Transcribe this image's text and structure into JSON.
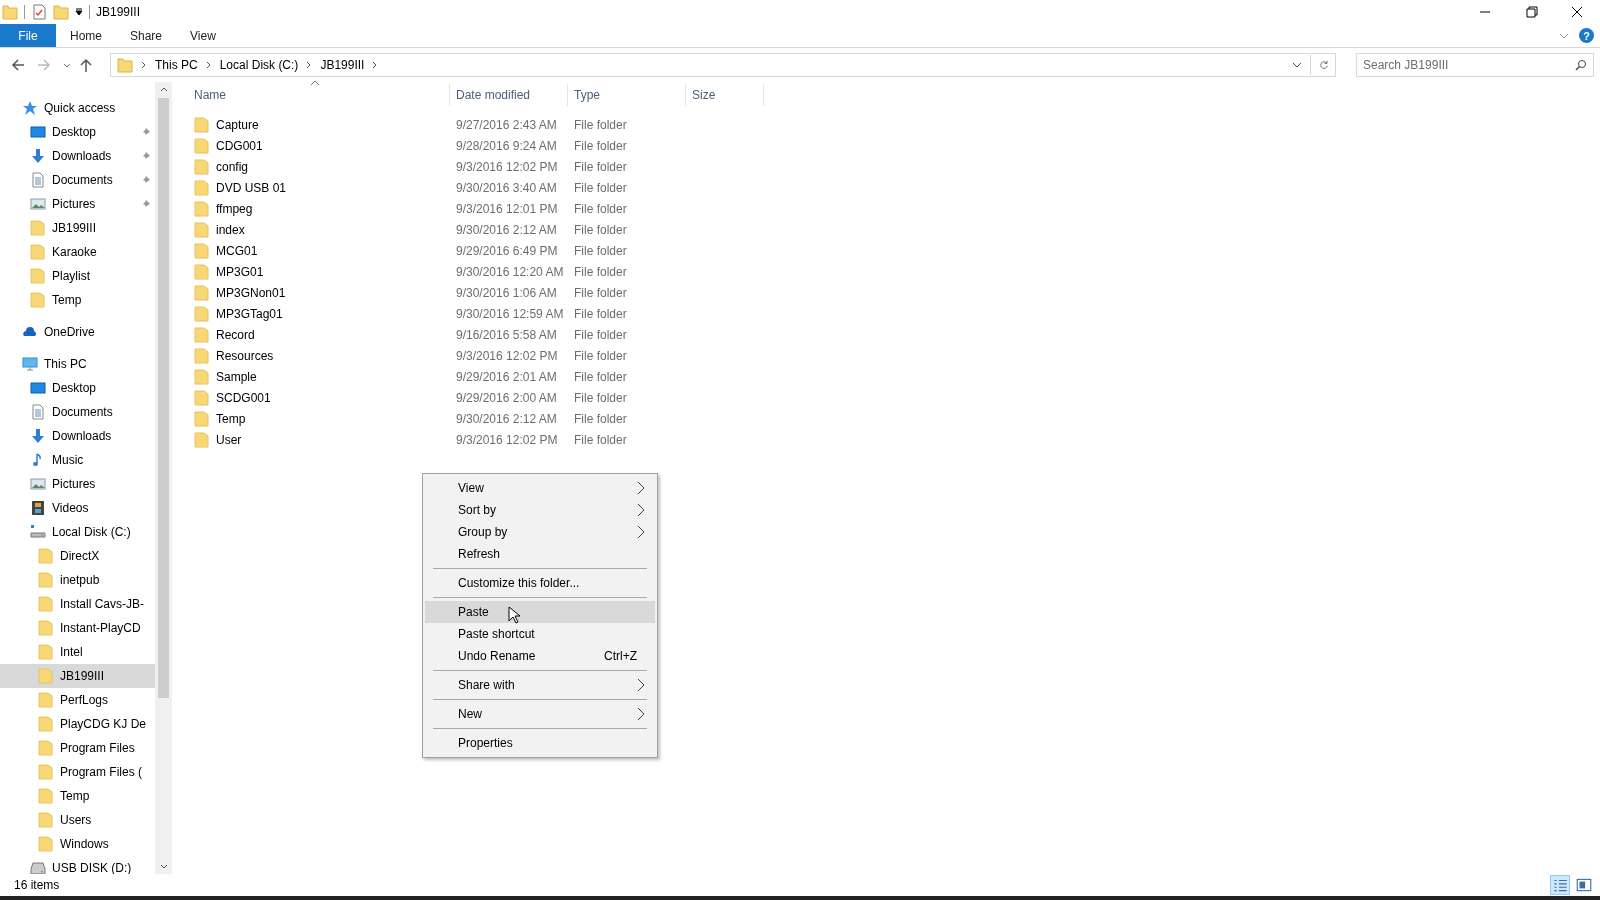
{
  "window": {
    "title": "JB199III",
    "help": "?"
  },
  "ribbon_tabs": [
    {
      "label": "File",
      "kind": "file",
      "selected": true
    },
    {
      "label": "Home",
      "kind": "tab",
      "selected": false
    },
    {
      "label": "Share",
      "kind": "tab",
      "selected": false
    },
    {
      "label": "View",
      "kind": "tab",
      "selected": false
    }
  ],
  "address_bar": {
    "path": [
      "This PC",
      "Local Disk (C:)",
      "JB199III"
    ]
  },
  "search": {
    "placeholder": "Search JB199III"
  },
  "sidebar": {
    "items": [
      {
        "label": "Quick access",
        "kind": "quick-access",
        "selected": false,
        "children": [
          {
            "label": "Desktop",
            "kind": "desktop",
            "pinned": true,
            "selected": false
          },
          {
            "label": "Downloads",
            "kind": "downloads",
            "pinned": true,
            "selected": false
          },
          {
            "label": "Documents",
            "kind": "documents",
            "pinned": true,
            "selected": false
          },
          {
            "label": "Pictures",
            "kind": "pictures",
            "pinned": true,
            "selected": false
          },
          {
            "label": "JB199III",
            "kind": "folder",
            "pinned": false,
            "selected": false
          },
          {
            "label": "Karaoke",
            "kind": "folder",
            "pinned": false,
            "selected": false
          },
          {
            "label": "Playlist",
            "kind": "folder",
            "pinned": false,
            "selected": false
          },
          {
            "label": "Temp",
            "kind": "folder",
            "pinned": false,
            "selected": false
          }
        ]
      },
      {
        "label": "OneDrive",
        "kind": "onedrive",
        "selected": false
      },
      {
        "label": "This PC",
        "kind": "pc",
        "selected": false,
        "children": [
          {
            "label": "Desktop",
            "kind": "desktop",
            "selected": false
          },
          {
            "label": "Documents",
            "kind": "documents",
            "selected": false
          },
          {
            "label": "Downloads",
            "kind": "downloads",
            "selected": false
          },
          {
            "label": "Music",
            "kind": "music",
            "selected": false
          },
          {
            "label": "Pictures",
            "kind": "pictures",
            "selected": false
          },
          {
            "label": "Videos",
            "kind": "videos",
            "selected": false
          },
          {
            "label": "Local Disk (C:)",
            "kind": "drive",
            "selected": false,
            "children": [
              {
                "label": "DirectX",
                "kind": "folder",
                "selected": false
              },
              {
                "label": "inetpub",
                "kind": "folder",
                "selected": false
              },
              {
                "label": "Install Cavs-JB-",
                "kind": "folder",
                "selected": false
              },
              {
                "label": "Instant-PlayCD",
                "kind": "folder",
                "selected": false
              },
              {
                "label": "Intel",
                "kind": "folder",
                "selected": false
              },
              {
                "label": "JB199III",
                "kind": "folder",
                "selected": true
              },
              {
                "label": "PerfLogs",
                "kind": "folder",
                "selected": false
              },
              {
                "label": "PlayCDG KJ De",
                "kind": "folder",
                "selected": false
              },
              {
                "label": "Program Files",
                "kind": "folder",
                "selected": false
              },
              {
                "label": "Program Files (",
                "kind": "folder",
                "selected": false
              },
              {
                "label": "Temp",
                "kind": "folder",
                "selected": false
              },
              {
                "label": "Users",
                "kind": "folder",
                "selected": false
              },
              {
                "label": "Windows",
                "kind": "folder",
                "selected": false
              }
            ]
          },
          {
            "label": "USB DISK (D:)",
            "kind": "usb",
            "selected": false
          }
        ]
      }
    ]
  },
  "table": {
    "columns": [
      {
        "label": "Name",
        "sorted": true
      },
      {
        "label": "Date modified",
        "sorted": false
      },
      {
        "label": "Type",
        "sorted": false
      },
      {
        "label": "Size",
        "sorted": false
      }
    ],
    "rows": [
      {
        "name": "Capture",
        "date": "9/27/2016 2:43 AM",
        "type": "File folder"
      },
      {
        "name": "CDG001",
        "date": "9/28/2016 9:24 AM",
        "type": "File folder"
      },
      {
        "name": "config",
        "date": "9/3/2016 12:02 PM",
        "type": "File folder"
      },
      {
        "name": "DVD USB 01",
        "date": "9/30/2016 3:40 AM",
        "type": "File folder"
      },
      {
        "name": "ffmpeg",
        "date": "9/3/2016 12:01 PM",
        "type": "File folder"
      },
      {
        "name": "index",
        "date": "9/30/2016 2:12 AM",
        "type": "File folder"
      },
      {
        "name": "MCG01",
        "date": "9/29/2016 6:49 PM",
        "type": "File folder"
      },
      {
        "name": "MP3G01",
        "date": "9/30/2016 12:20 AM",
        "type": "File folder"
      },
      {
        "name": "MP3GNon01",
        "date": "9/30/2016 1:06 AM",
        "type": "File folder"
      },
      {
        "name": "MP3GTag01",
        "date": "9/30/2016 12:59 AM",
        "type": "File folder"
      },
      {
        "name": "Record",
        "date": "9/16/2016 5:58 AM",
        "type": "File folder"
      },
      {
        "name": "Resources",
        "date": "9/3/2016 12:02 PM",
        "type": "File folder"
      },
      {
        "name": "Sample",
        "date": "9/29/2016 2:01 AM",
        "type": "File folder"
      },
      {
        "name": "SCDG001",
        "date": "9/29/2016 2:00 AM",
        "type": "File folder"
      },
      {
        "name": "Temp",
        "date": "9/30/2016 2:12 AM",
        "type": "File folder"
      },
      {
        "name": "User",
        "date": "9/3/2016 12:02 PM",
        "type": "File folder"
      }
    ]
  },
  "context_menu": {
    "groups": [
      {
        "items": [
          {
            "label": "View",
            "submenu": true,
            "selected": false
          },
          {
            "label": "Sort by",
            "submenu": true,
            "selected": false
          },
          {
            "label": "Group by",
            "submenu": true,
            "selected": false
          },
          {
            "label": "Refresh",
            "submenu": false,
            "selected": false
          }
        ]
      },
      {
        "items": [
          {
            "label": "Customize this folder...",
            "submenu": false,
            "selected": false
          }
        ]
      },
      {
        "items": [
          {
            "label": "Paste",
            "submenu": false,
            "selected": true
          },
          {
            "label": "Paste shortcut",
            "submenu": false,
            "selected": false
          },
          {
            "label": "Undo Rename",
            "shortcut": "Ctrl+Z",
            "submenu": false,
            "selected": false
          }
        ]
      },
      {
        "items": [
          {
            "label": "Share with",
            "submenu": true,
            "selected": false
          }
        ]
      },
      {
        "items": [
          {
            "label": "New",
            "submenu": true,
            "selected": false
          }
        ]
      },
      {
        "items": [
          {
            "label": "Properties",
            "submenu": false,
            "selected": false
          }
        ]
      }
    ]
  },
  "status_bar": {
    "count": "16 items"
  },
  "view_buttons": [
    {
      "kind": "details",
      "selected": true
    },
    {
      "kind": "tiles",
      "selected": false
    }
  ]
}
